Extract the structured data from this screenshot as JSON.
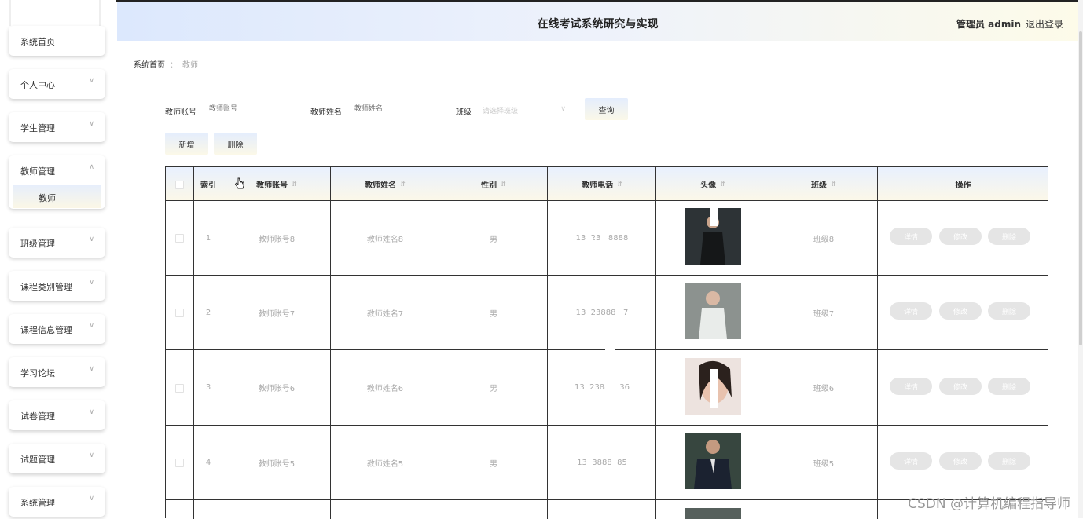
{
  "header": {
    "title": "在线考试系统研究与实现",
    "user": "管理员 admin",
    "logout": "退出登录"
  },
  "sidebar": {
    "items": [
      {
        "label": "系统首页",
        "chevron": false
      },
      {
        "label": "个人中心",
        "chevron": true
      },
      {
        "label": "学生管理",
        "chevron": true
      },
      {
        "label": "教师管理",
        "chevron": true,
        "open": true,
        "sub": "教师"
      },
      {
        "label": "班级管理",
        "chevron": true
      },
      {
        "label": "课程类别管理",
        "chevron": true
      },
      {
        "label": "课程信息管理",
        "chevron": true
      },
      {
        "label": "学习论坛",
        "chevron": true
      },
      {
        "label": "试卷管理",
        "chevron": true
      },
      {
        "label": "试题管理",
        "chevron": true
      },
      {
        "label": "系统管理",
        "chevron": true
      }
    ]
  },
  "breadcrumb": {
    "home": "系统首页",
    "sep": "：",
    "current": "教师"
  },
  "search": {
    "account_label": "教师账号",
    "account_placeholder": "教师账号",
    "name_label": "教师姓名",
    "name_placeholder": "教师姓名",
    "class_label": "班级",
    "class_placeholder": "请选择班级",
    "query_button": "查询",
    "add_button": "新增",
    "delete_button": "删除"
  },
  "table": {
    "columns": [
      "索引",
      "教师账号",
      "教师姓名",
      "性别",
      "教师电话",
      "头像",
      "班级",
      "操作"
    ],
    "rows": [
      {
        "index": "1",
        "account": "教师账号8",
        "name": "教师姓名8",
        "gender": "男",
        "phone": "13  23   8888",
        "class": "班级8"
      },
      {
        "index": "2",
        "account": "教师账号7",
        "name": "教师姓名7",
        "gender": "男",
        "phone": "13  23888   7",
        "class": "班级7"
      },
      {
        "index": "3",
        "account": "教师账号6",
        "name": "教师姓名6",
        "gender": "男",
        "phone": "13  23888  36",
        "class": "班级6"
      },
      {
        "index": "4",
        "account": "教师账号5",
        "name": "教师姓名5",
        "gender": "男",
        "phone": "13  3888  85",
        "class": "班级5"
      }
    ],
    "actions": {
      "detail": "详情",
      "edit": "修改",
      "delete": "删除"
    }
  },
  "watermark": "CSDN @计算机编程指导师",
  "colors": {
    "header_gradient_start": "#dce8fd",
    "header_gradient_end": "#fdfbe9",
    "op_button": "#e5e5e5",
    "table_border": "#333333"
  }
}
